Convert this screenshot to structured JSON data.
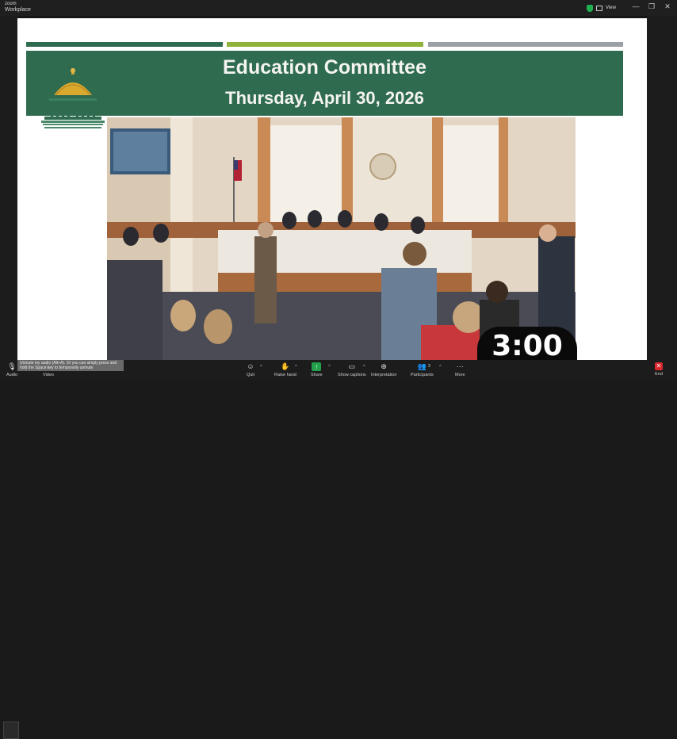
{
  "window": {
    "app_name_line1": "zoom",
    "app_name_line2": "Workplace",
    "view_label": "View",
    "controls": [
      "—",
      "❐",
      "✕"
    ]
  },
  "slide": {
    "title": "Education Committee",
    "date": "Thursday, April 30, 2026",
    "stripe_colors": [
      "#2f6b4f",
      "#8fb33a",
      "#9aa0a6"
    ],
    "banner_color": "#2f6b4f"
  },
  "timer": {
    "value": "3:00"
  },
  "tooltip": {
    "text": "Unmute my audio (Alt+A). Or you can simply press and hold the Space key to temporarily unmute"
  },
  "toolbar": {
    "audio": "Audio",
    "video": "Video",
    "quit": "Quit",
    "raise_hand": "Raise hand",
    "share": "Share",
    "show_captions": "Show captions",
    "interpretation": "Interpretation",
    "participants": "Participants",
    "participants_count": "3",
    "more": "More",
    "end": "End"
  }
}
